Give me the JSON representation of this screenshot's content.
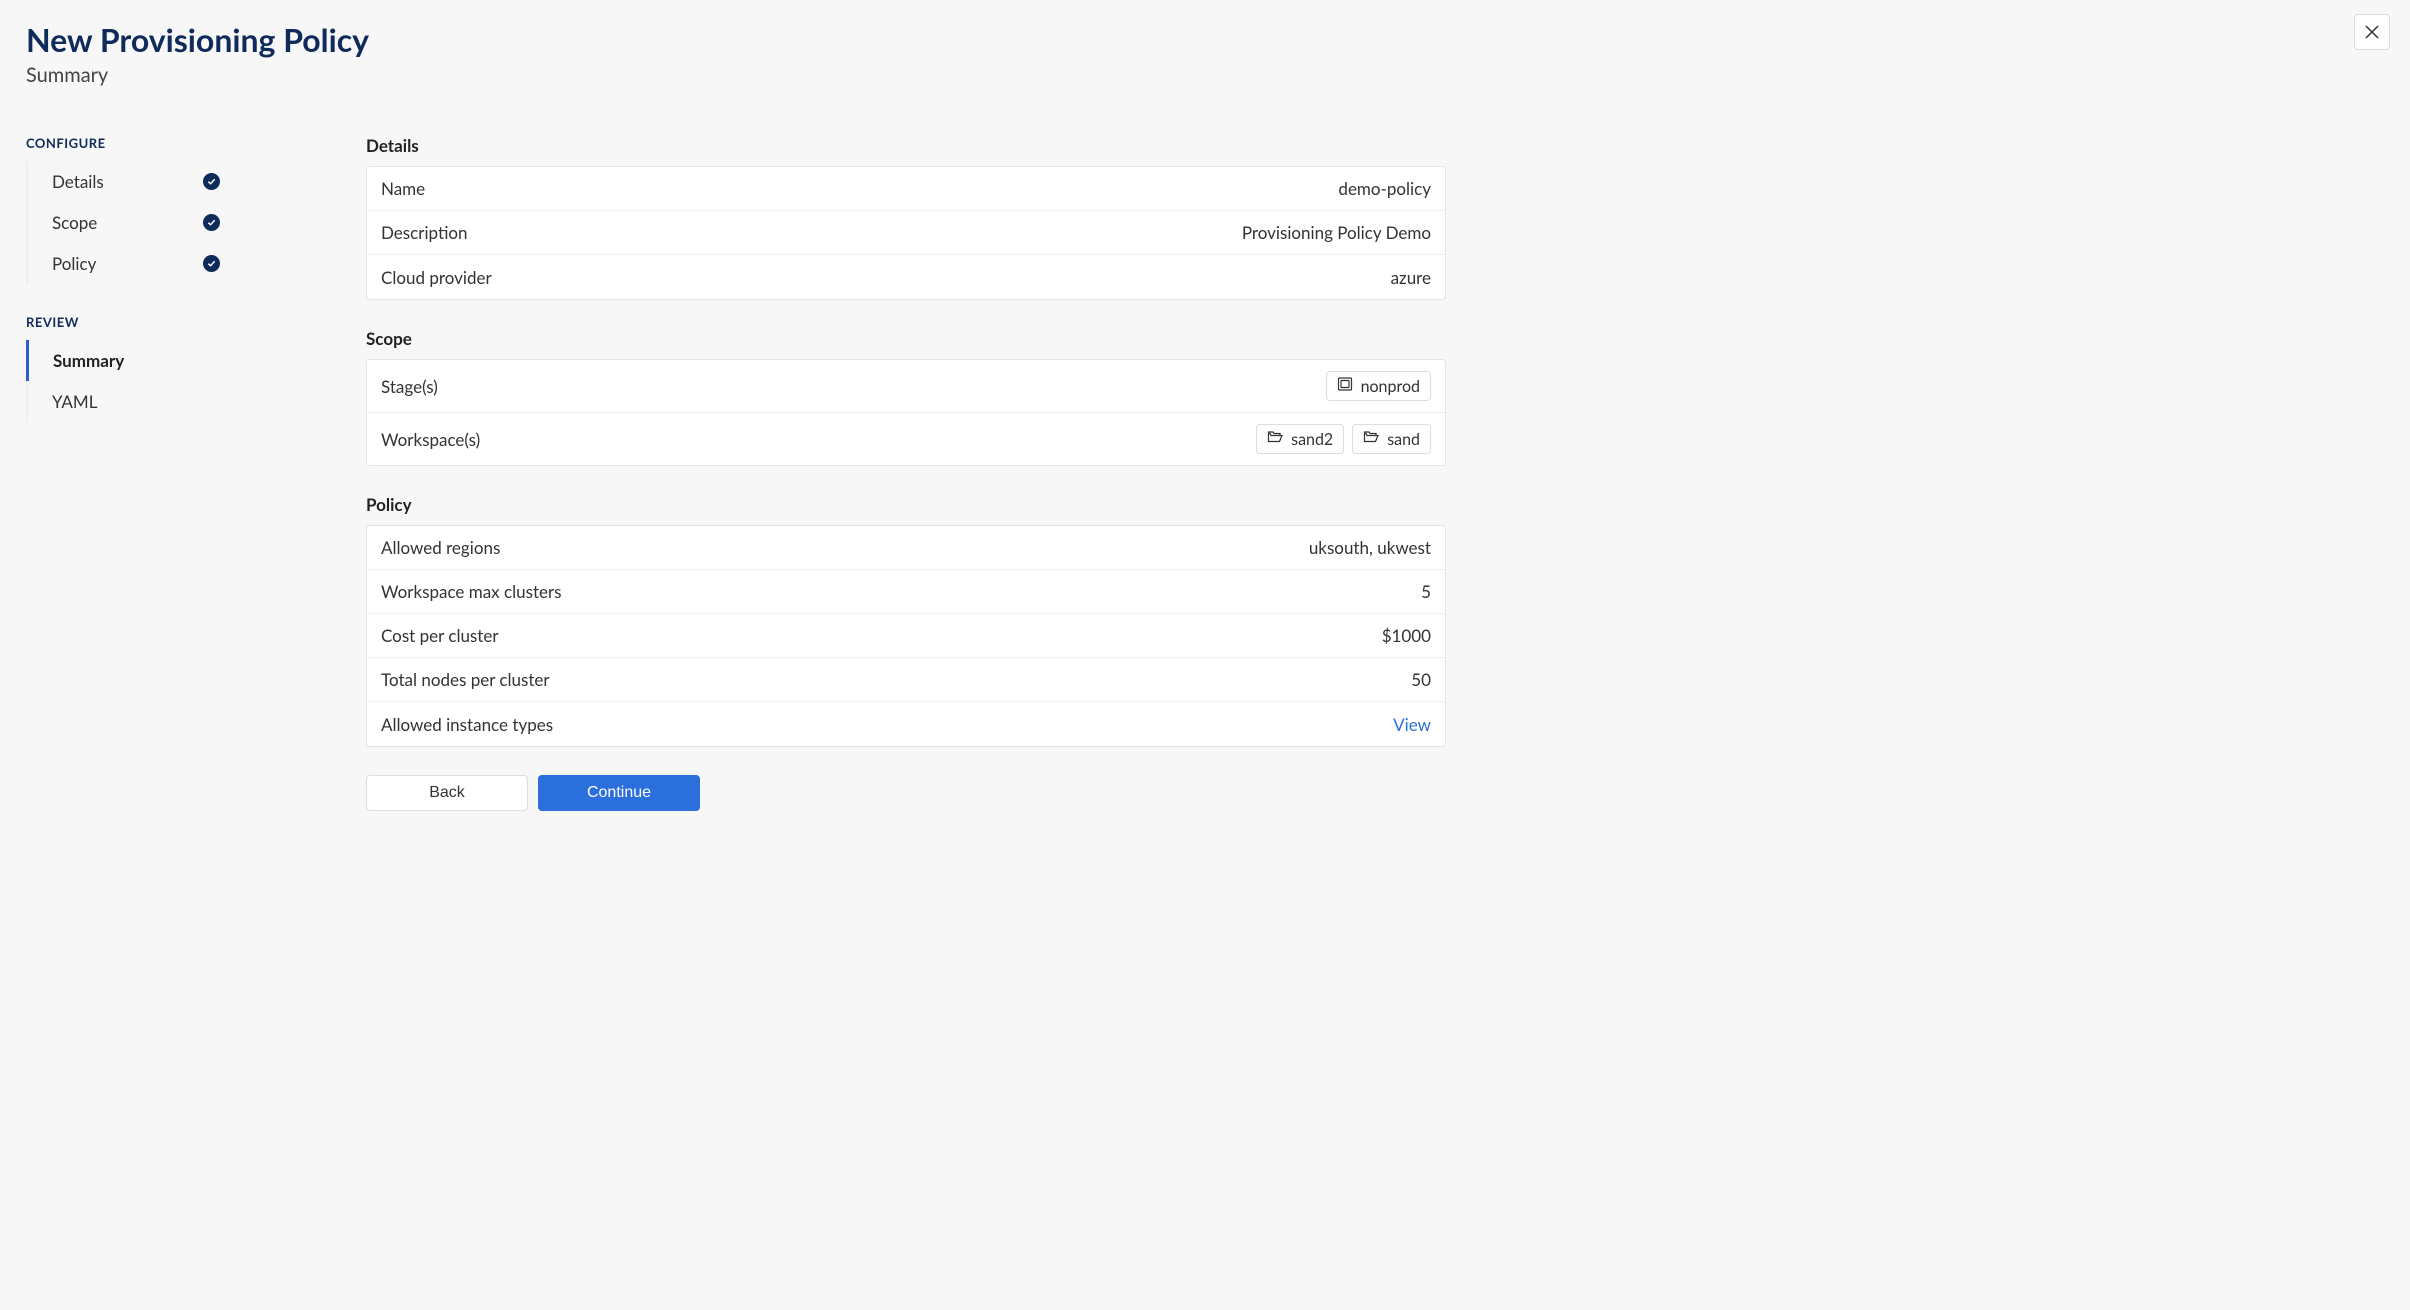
{
  "header": {
    "title": "New Provisioning Policy",
    "subtitle": "Summary"
  },
  "sidebar": {
    "configure_label": "CONFIGURE",
    "review_label": "REVIEW",
    "configure_items": [
      {
        "label": "Details",
        "done": true
      },
      {
        "label": "Scope",
        "done": true
      },
      {
        "label": "Policy",
        "done": true
      }
    ],
    "review_items": [
      {
        "label": "Summary",
        "active": true
      },
      {
        "label": "YAML",
        "active": false
      }
    ]
  },
  "details": {
    "heading": "Details",
    "rows": {
      "name": {
        "label": "Name",
        "value": "demo-policy"
      },
      "description": {
        "label": "Description",
        "value": "Provisioning Policy Demo"
      },
      "cloud": {
        "label": "Cloud provider",
        "value": "azure"
      }
    }
  },
  "scope": {
    "heading": "Scope",
    "stages_label": "Stage(s)",
    "workspaces_label": "Workspace(s)",
    "stages": [
      "nonprod"
    ],
    "workspaces": [
      "sand2",
      "sand"
    ]
  },
  "policy": {
    "heading": "Policy",
    "rows": {
      "regions": {
        "label": "Allowed regions",
        "value": "uksouth, ukwest"
      },
      "max_clusters": {
        "label": "Workspace max clusters",
        "value": "5"
      },
      "cost": {
        "label": "Cost per cluster",
        "value": "$1000"
      },
      "nodes": {
        "label": "Total nodes per cluster",
        "value": "50"
      },
      "instance_types": {
        "label": "Allowed instance types",
        "value": "View"
      }
    }
  },
  "buttons": {
    "back": "Back",
    "continue": "Continue"
  }
}
